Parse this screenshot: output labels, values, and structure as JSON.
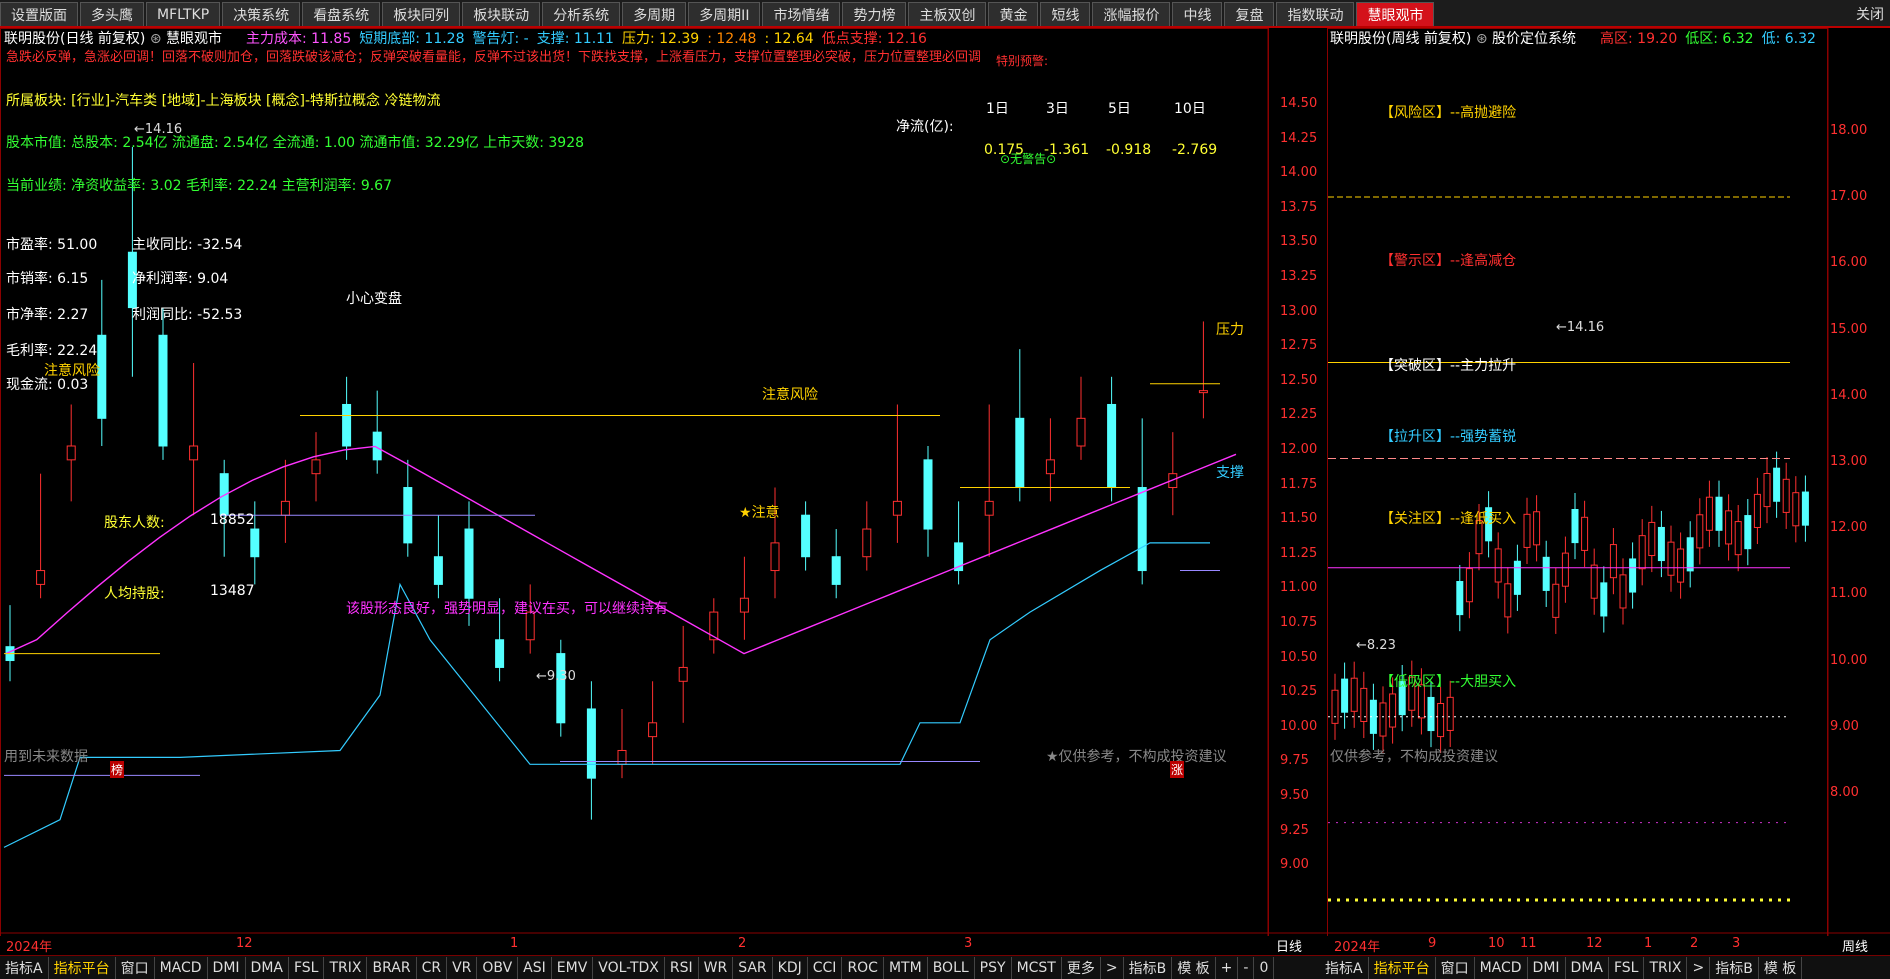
{
  "tabs": [
    "设置版面",
    "多头鹰",
    "MFLTKP",
    "决策系统",
    "看盘系统",
    "板块同列",
    "板块联动",
    "分析系统",
    "多周期",
    "多周期II",
    "市场情绪",
    "势力榜",
    "主板双创",
    "黄金",
    "短线",
    "涨幅报价",
    "中线",
    "复盘",
    "指数联动",
    "慧眼观市"
  ],
  "active_tab": "慧眼观市",
  "close_label": "关闭",
  "left": {
    "title": "联明股份(日线 前复权)",
    "indicator_name": "慧眼观市",
    "header_items": [
      {
        "label": "主力成本: ",
        "value": "11.85",
        "color": "#ff55ff"
      },
      {
        "label": "短期底部: ",
        "value": "11.28",
        "color": "#33ccff"
      },
      {
        "label": "警告灯: ",
        "value": "-",
        "color": "#33ccff"
      },
      {
        "label": "支撑: ",
        "value": "11.11",
        "color": "#33ccff"
      },
      {
        "label": "压力: ",
        "value": "12.39",
        "color": "#ffd200"
      },
      {
        "label": ": ",
        "value": "12.48",
        "color": "#ff8800"
      },
      {
        "label": ": ",
        "value": "12.64",
        "color": "#ffd200"
      },
      {
        "label": "低点支撑: ",
        "value": "12.16",
        "color": "#ff3030"
      }
    ],
    "warning_line": "急跌必反弹，急涨必回调！回落不破则加仓，回落跌破该减仓；反弹突破看量能，反弹不过该出货！下跌找支撑，上涨看压力，支撑位置整理必突破，压力位置整理必回调",
    "sector": "所属板块: [行业]-汽车类 [地域]-上海板块 [概念]-特斯拉概念 冷链物流",
    "capital": "股本市值: 总股本: 2.54亿 流通盘: 2.54亿 全流通: 1.00 流通市值: 32.29亿 上市天数: 3928",
    "performance": "当前业绩: 净资收益率: 3.02 毛利率: 22.24 主营利润率: 9.67",
    "ratios": [
      {
        "label": "市盈率: 51.00",
        "side": "主收同比: -32.54"
      },
      {
        "label": "市销率: 6.15",
        "side": "净利润率: 9.04"
      },
      {
        "label": "市净率: 2.27",
        "side": "利润同比: -52.53"
      },
      {
        "label": "毛利率: 22.24",
        "side": ""
      },
      {
        "label": "现金流: 0.03",
        "side": ""
      }
    ],
    "flow_title": "净流(亿):",
    "flow_headers": [
      "1日",
      "3日",
      "5日",
      "10日"
    ],
    "flow_values": [
      "0.175",
      "-1.361",
      "-0.918",
      "-2.769"
    ],
    "flow_status": "无警告",
    "alert_label": "特别预警:",
    "annotations": {
      "caution_change": "小心变盘",
      "risk1": "注意风险",
      "risk2": "注意风险",
      "attention": "注意",
      "pressure": "压力",
      "support": "支撑",
      "shareholders_label": "股东人数:",
      "shareholders_value": "18852",
      "avg_holding_label": "人均持股:",
      "avg_holding_value": "13487",
      "pattern_comment": "该股形态良好，强势明显，建议在买，可以继续持有",
      "future_data": "用到未来数据",
      "disclaimer": "★仅供参考，不构成投资建议",
      "high_mark": "14.16",
      "low_mark": "9.30",
      "limit_up_badge": "涨",
      "b_badge": "榜"
    },
    "y_ticks": [
      "14.50",
      "14.25",
      "14.00",
      "13.75",
      "13.50",
      "13.25",
      "13.00",
      "12.75",
      "12.50",
      "12.25",
      "12.00",
      "11.75",
      "11.50",
      "11.25",
      "11.00",
      "10.75",
      "10.50",
      "10.25",
      "10.00",
      "9.75",
      "9.50",
      "9.25",
      "9.00"
    ],
    "x_labels": [
      "2024年",
      "12",
      "1",
      "2",
      "3"
    ],
    "period_label": "日线"
  },
  "right": {
    "title": "联明股份(周线 前复权)",
    "indicator_name": "股价定位系统",
    "header_items": [
      {
        "label": "高区: ",
        "value": "19.20",
        "color": "#ff3030"
      },
      {
        "label": "低区: ",
        "value": "6.32",
        "color": "#33ff33"
      },
      {
        "label": "低: ",
        "value": "6.32",
        "color": "#33ccff"
      }
    ],
    "zones": [
      {
        "label": "【风险区】--高抛避险",
        "color": "#ffd200"
      },
      {
        "label": "【警示区】--逢高减仓",
        "color": "#ff3030"
      },
      {
        "label": "【突破区】--主力拉升",
        "color": "#ffffff"
      },
      {
        "label": "【拉升区】--强势蓄锐",
        "color": "#33ccff"
      },
      {
        "label": "【关注区】--逢低买入",
        "color": "#ffd200"
      },
      {
        "label": "【低吸区】--大胆买入",
        "color": "#33ff33"
      }
    ],
    "high_mark": "14.16",
    "low_mark": "8.23",
    "disclaimer": "仅供参考，不构成投资建议",
    "y_ticks": [
      "18.00",
      "17.00",
      "16.00",
      "15.00",
      "14.00",
      "13.00",
      "12.00",
      "11.00",
      "10.00",
      "9.00",
      "8.00"
    ],
    "x_labels": [
      "2024年",
      "9",
      "10",
      "11",
      "12",
      "1",
      "2",
      "3"
    ],
    "period_label": "周线"
  },
  "bottom_left_tabs": [
    "指标A",
    "指标平台",
    "窗口",
    "MACD",
    "DMI",
    "DMA",
    "FSL",
    "TRIX",
    "BRAR",
    "CR",
    "VR",
    "OBV",
    "ASI",
    "EMV",
    "VOL-TDX",
    "RSI",
    "WR",
    "SAR",
    "KDJ",
    "CCI",
    "ROC",
    "MTM",
    "BOLL",
    "PSY",
    "MCST",
    "更多",
    ">",
    "指标B",
    "模 板",
    "+",
    "-",
    "0"
  ],
  "bottom_right_tabs": [
    "指标A",
    "指标平台",
    "窗口",
    "MACD",
    "DMI",
    "DMA",
    "FSL",
    "TRIX",
    ">",
    "指标B",
    "模 板"
  ],
  "colors": {
    "up": "#ff3030",
    "down": "#54ffff",
    "ma": "#ff33ff",
    "support_line": "#33ccff"
  }
}
